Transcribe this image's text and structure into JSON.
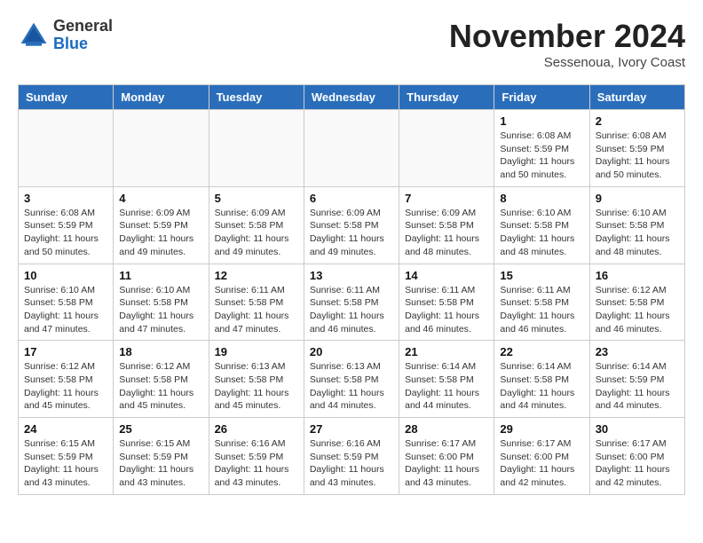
{
  "logo": {
    "general": "General",
    "blue": "Blue"
  },
  "header": {
    "month": "November 2024",
    "location": "Sessenoua, Ivory Coast"
  },
  "weekdays": [
    "Sunday",
    "Monday",
    "Tuesday",
    "Wednesday",
    "Thursday",
    "Friday",
    "Saturday"
  ],
  "weeks": [
    [
      {
        "day": "",
        "info": ""
      },
      {
        "day": "",
        "info": ""
      },
      {
        "day": "",
        "info": ""
      },
      {
        "day": "",
        "info": ""
      },
      {
        "day": "",
        "info": ""
      },
      {
        "day": "1",
        "info": "Sunrise: 6:08 AM\nSunset: 5:59 PM\nDaylight: 11 hours\nand 50 minutes."
      },
      {
        "day": "2",
        "info": "Sunrise: 6:08 AM\nSunset: 5:59 PM\nDaylight: 11 hours\nand 50 minutes."
      }
    ],
    [
      {
        "day": "3",
        "info": "Sunrise: 6:08 AM\nSunset: 5:59 PM\nDaylight: 11 hours\nand 50 minutes."
      },
      {
        "day": "4",
        "info": "Sunrise: 6:09 AM\nSunset: 5:59 PM\nDaylight: 11 hours\nand 49 minutes."
      },
      {
        "day": "5",
        "info": "Sunrise: 6:09 AM\nSunset: 5:58 PM\nDaylight: 11 hours\nand 49 minutes."
      },
      {
        "day": "6",
        "info": "Sunrise: 6:09 AM\nSunset: 5:58 PM\nDaylight: 11 hours\nand 49 minutes."
      },
      {
        "day": "7",
        "info": "Sunrise: 6:09 AM\nSunset: 5:58 PM\nDaylight: 11 hours\nand 48 minutes."
      },
      {
        "day": "8",
        "info": "Sunrise: 6:10 AM\nSunset: 5:58 PM\nDaylight: 11 hours\nand 48 minutes."
      },
      {
        "day": "9",
        "info": "Sunrise: 6:10 AM\nSunset: 5:58 PM\nDaylight: 11 hours\nand 48 minutes."
      }
    ],
    [
      {
        "day": "10",
        "info": "Sunrise: 6:10 AM\nSunset: 5:58 PM\nDaylight: 11 hours\nand 47 minutes."
      },
      {
        "day": "11",
        "info": "Sunrise: 6:10 AM\nSunset: 5:58 PM\nDaylight: 11 hours\nand 47 minutes."
      },
      {
        "day": "12",
        "info": "Sunrise: 6:11 AM\nSunset: 5:58 PM\nDaylight: 11 hours\nand 47 minutes."
      },
      {
        "day": "13",
        "info": "Sunrise: 6:11 AM\nSunset: 5:58 PM\nDaylight: 11 hours\nand 46 minutes."
      },
      {
        "day": "14",
        "info": "Sunrise: 6:11 AM\nSunset: 5:58 PM\nDaylight: 11 hours\nand 46 minutes."
      },
      {
        "day": "15",
        "info": "Sunrise: 6:11 AM\nSunset: 5:58 PM\nDaylight: 11 hours\nand 46 minutes."
      },
      {
        "day": "16",
        "info": "Sunrise: 6:12 AM\nSunset: 5:58 PM\nDaylight: 11 hours\nand 46 minutes."
      }
    ],
    [
      {
        "day": "17",
        "info": "Sunrise: 6:12 AM\nSunset: 5:58 PM\nDaylight: 11 hours\nand 45 minutes."
      },
      {
        "day": "18",
        "info": "Sunrise: 6:12 AM\nSunset: 5:58 PM\nDaylight: 11 hours\nand 45 minutes."
      },
      {
        "day": "19",
        "info": "Sunrise: 6:13 AM\nSunset: 5:58 PM\nDaylight: 11 hours\nand 45 minutes."
      },
      {
        "day": "20",
        "info": "Sunrise: 6:13 AM\nSunset: 5:58 PM\nDaylight: 11 hours\nand 44 minutes."
      },
      {
        "day": "21",
        "info": "Sunrise: 6:14 AM\nSunset: 5:58 PM\nDaylight: 11 hours\nand 44 minutes."
      },
      {
        "day": "22",
        "info": "Sunrise: 6:14 AM\nSunset: 5:58 PM\nDaylight: 11 hours\nand 44 minutes."
      },
      {
        "day": "23",
        "info": "Sunrise: 6:14 AM\nSunset: 5:59 PM\nDaylight: 11 hours\nand 44 minutes."
      }
    ],
    [
      {
        "day": "24",
        "info": "Sunrise: 6:15 AM\nSunset: 5:59 PM\nDaylight: 11 hours\nand 43 minutes."
      },
      {
        "day": "25",
        "info": "Sunrise: 6:15 AM\nSunset: 5:59 PM\nDaylight: 11 hours\nand 43 minutes."
      },
      {
        "day": "26",
        "info": "Sunrise: 6:16 AM\nSunset: 5:59 PM\nDaylight: 11 hours\nand 43 minutes."
      },
      {
        "day": "27",
        "info": "Sunrise: 6:16 AM\nSunset: 5:59 PM\nDaylight: 11 hours\nand 43 minutes."
      },
      {
        "day": "28",
        "info": "Sunrise: 6:17 AM\nSunset: 6:00 PM\nDaylight: 11 hours\nand 43 minutes."
      },
      {
        "day": "29",
        "info": "Sunrise: 6:17 AM\nSunset: 6:00 PM\nDaylight: 11 hours\nand 42 minutes."
      },
      {
        "day": "30",
        "info": "Sunrise: 6:17 AM\nSunset: 6:00 PM\nDaylight: 11 hours\nand 42 minutes."
      }
    ]
  ]
}
